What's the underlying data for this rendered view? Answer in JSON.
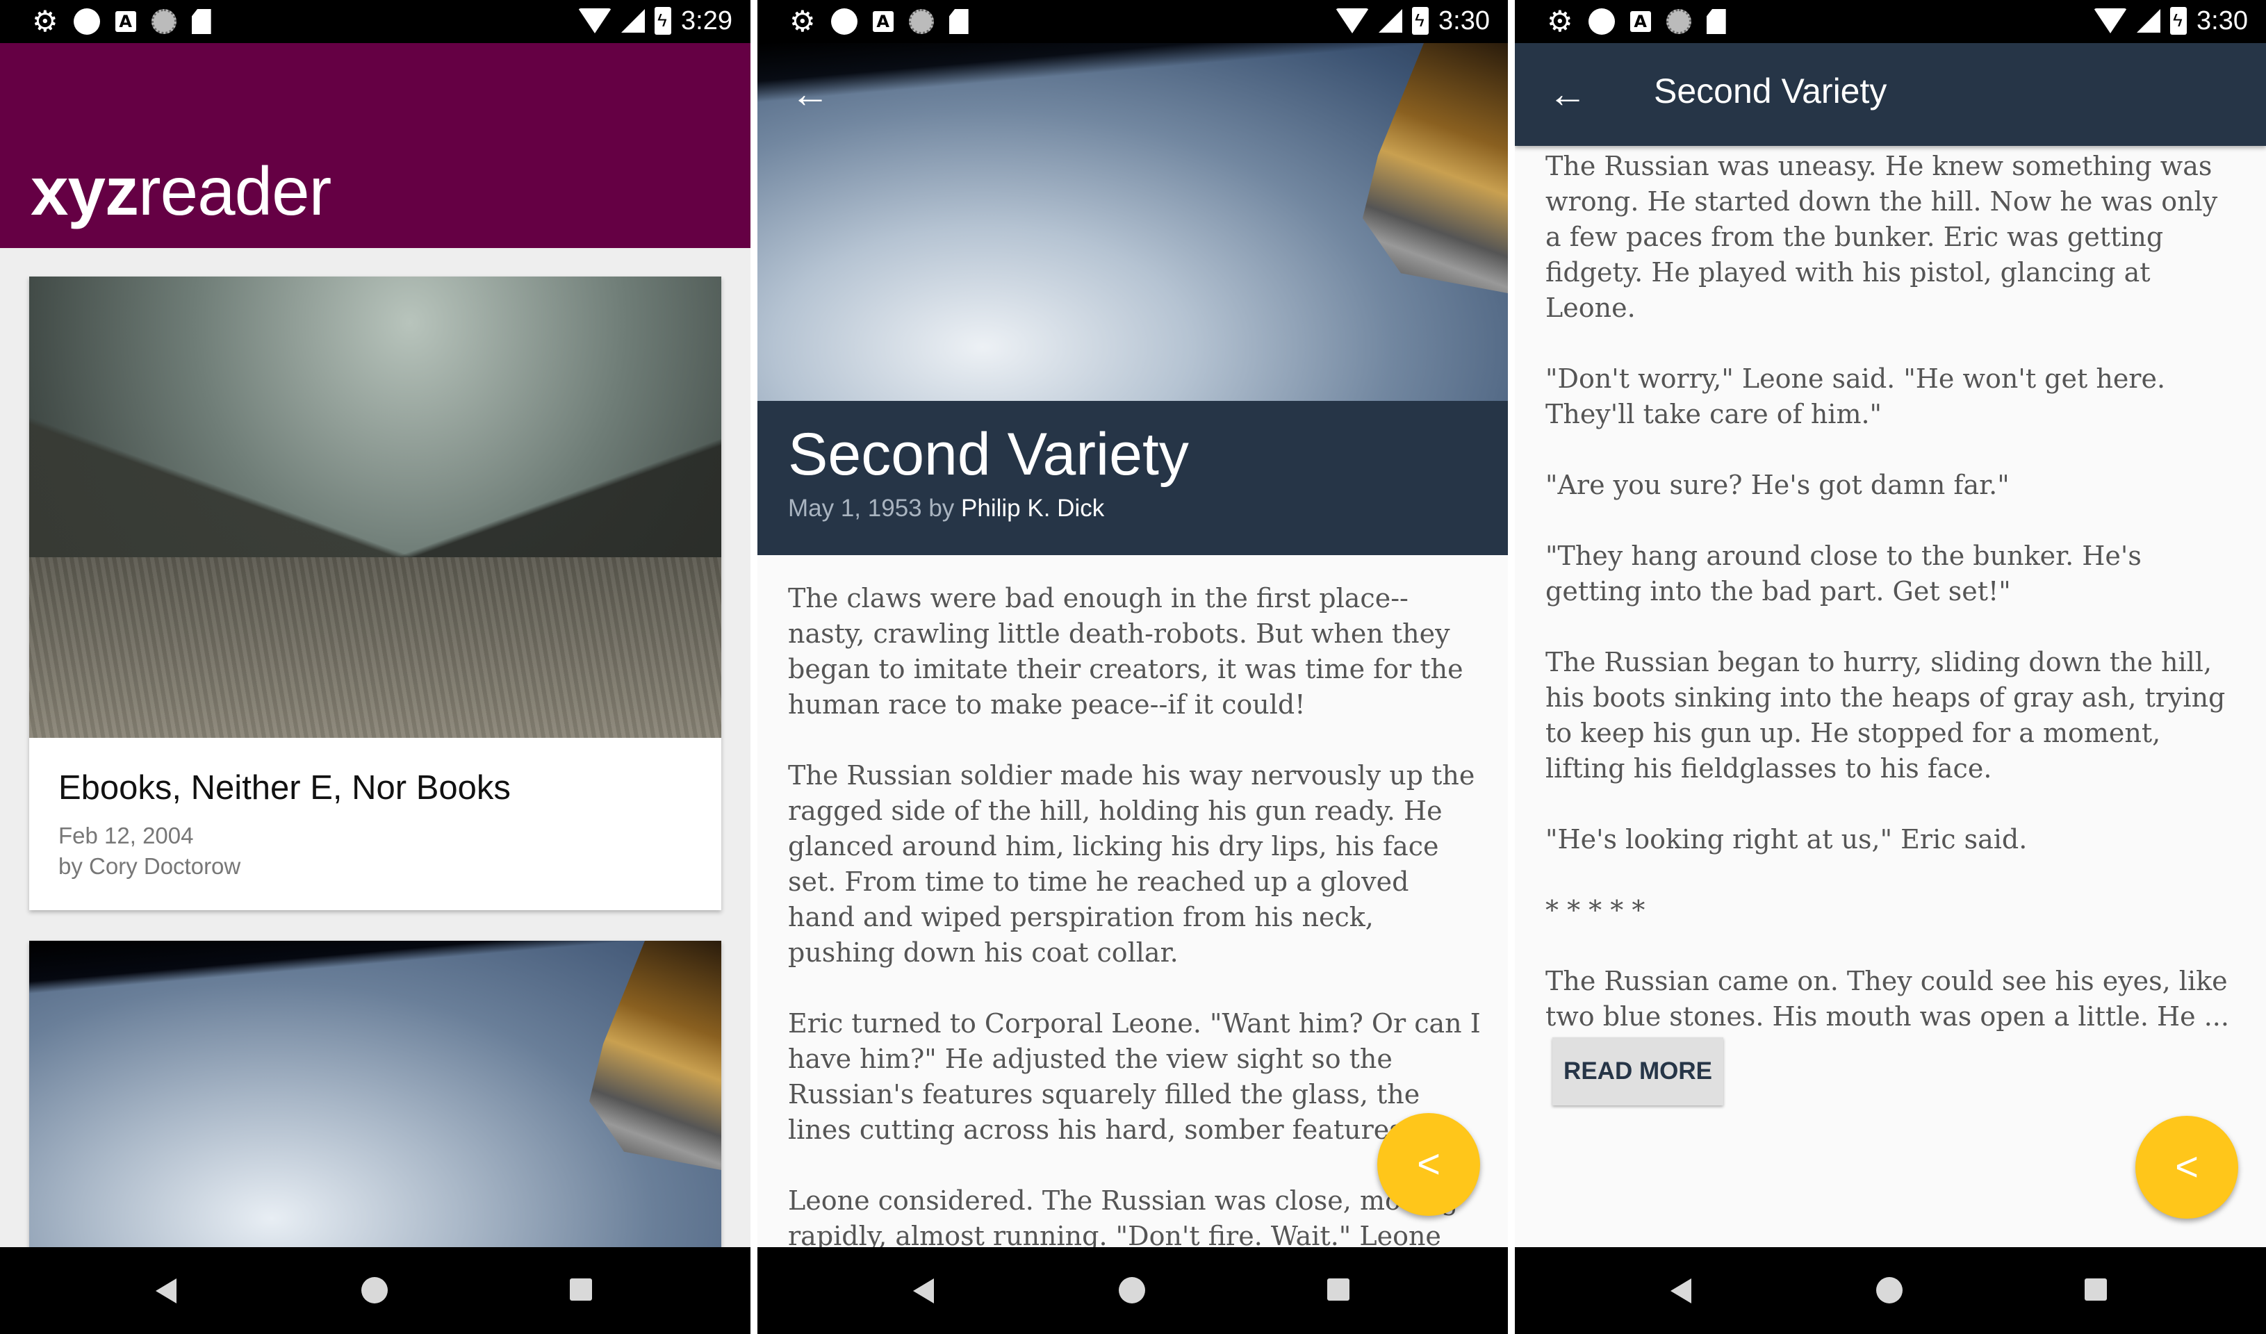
{
  "status_bars": [
    {
      "time": "3:29"
    },
    {
      "time": "3:30"
    },
    {
      "time": "3:30"
    }
  ],
  "list_screen": {
    "logo_bold": "xyz",
    "logo_rest": "reader",
    "cards": [
      {
        "title": "Ebooks, Neither E, Nor Books",
        "date": "Feb 12, 2004",
        "author": "by Cory Doctorow"
      },
      {
        "title": "",
        "date": "",
        "author": ""
      }
    ],
    "colors": {
      "appbar": "#650044"
    }
  },
  "detail_screen": {
    "title": "Second Variety",
    "date_prefix": "May 1, 1953 by ",
    "author": "Philip K. Dick",
    "paragraphs": [
      "The claws were bad enough in the first place--nasty, crawling little death-robots. But when they began to imitate their creators, it was time for the human race to make peace--if it could!",
      "The Russian soldier made his way nervously up the ragged side of the hill, holding his gun ready. He glanced around him, licking his dry lips, his face set. From time to time he reached up a gloved hand and wiped perspiration from his neck, pushing down his coat collar.",
      "Eric turned to Corporal Leone. \"Want him? Or can I have him?\" He adjusted the view sight so the Russian's features squarely filled the glass, the lines cutting across his hard, somber features.",
      "Leone considered. The Russian was close, moving rapidly, almost running. \"Don't fire. Wait.\" Leone tensed"
    ],
    "colors": {
      "title_bg": "#263547",
      "fab": "#ffc61a"
    }
  },
  "scrolled_screen": {
    "toolbar_title": "Second Variety",
    "paragraphs": [
      "The Russian was uneasy. He knew something was wrong. He started down the hill. Now he was only a few paces from the bunker. Eric was getting fidgety. He played with his pistol, glancing at Leone.",
      "\"Don't worry,\" Leone said. \"He won't get here. They'll take care of him.\"",
      "\"Are you sure? He's got damn far.\"",
      "\"They hang around close to the bunker. He's getting into the bad part. Get set!\"",
      "The Russian began to hurry, sliding down the hill, his boots sinking into the heaps of gray ash, trying to keep his gun up. He stopped for a moment, lifting his fieldglasses to his face.",
      "\"He's looking right at us,\" Eric said.",
      "* * * * *",
      "The Russian came on. They could see his eyes, like two blue stones. His mouth was open a little. He ..."
    ],
    "read_more_label": "READ MORE"
  },
  "icons": {
    "back": "arrow-left-icon",
    "share": "share-icon",
    "nav_back": "triangle-back-icon",
    "nav_home": "circle-home-icon",
    "nav_recent": "square-recents-icon"
  }
}
